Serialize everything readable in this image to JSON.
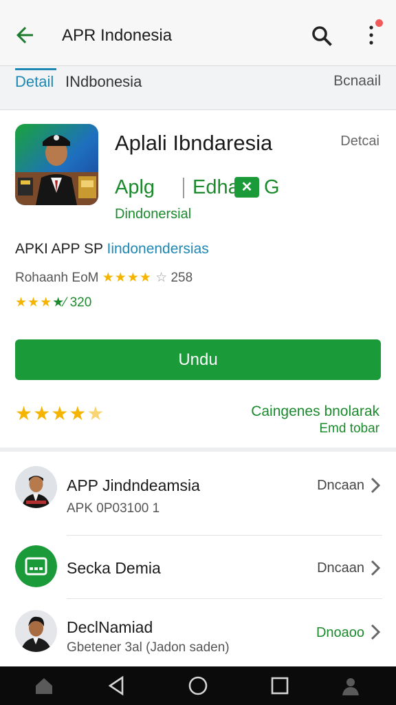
{
  "appbar": {
    "title": "APR Indonesia",
    "icons": {
      "back": "arrow-back-icon",
      "search": "search-icon",
      "more": "more-vert-icon"
    },
    "accent": "#1b8a2c"
  },
  "tabs": {
    "detail": "Detail",
    "name": "INdbonesia",
    "right": "Bcnaail"
  },
  "app": {
    "title": "Aplali Ibndaresia",
    "detail_link": "Detcai",
    "sub1": "Aplg",
    "sub2": "Edha",
    "badge": "✕",
    "badge_suffix": "G",
    "developer": "Dindonersial",
    "apk_part1": "APKI APP SP",
    "apk_part2": "Iindonendersias",
    "rating_label": "Rohaanh EoM",
    "rating_count_1": "258",
    "rating_count_2": "320",
    "install_label": "Undu",
    "category_line1": "Caingenes bnolarak",
    "category_line2": "Emd tobar",
    "brand_green": "#1b9a3a",
    "link_blue": "#1e88b4",
    "star_color": "#f4b400"
  },
  "list": [
    {
      "title": "APP Jindndeamsia",
      "subtitle": "APK 0P03100 1",
      "action": "Dncaan",
      "icon": "person-avatar"
    },
    {
      "title": "Secka Demia",
      "subtitle": "",
      "action": "Dncaan",
      "icon": "app-grid-icon"
    },
    {
      "title": "DeclNamiad",
      "subtitle": "Gbetener 3al (Jadon saden)",
      "action": "Dnoaoo",
      "icon": "person-avatar"
    }
  ],
  "navbar": {
    "icons": [
      "home-icon",
      "back-triangle-icon",
      "home-circle-icon",
      "recents-square-icon",
      "profile-icon"
    ]
  }
}
